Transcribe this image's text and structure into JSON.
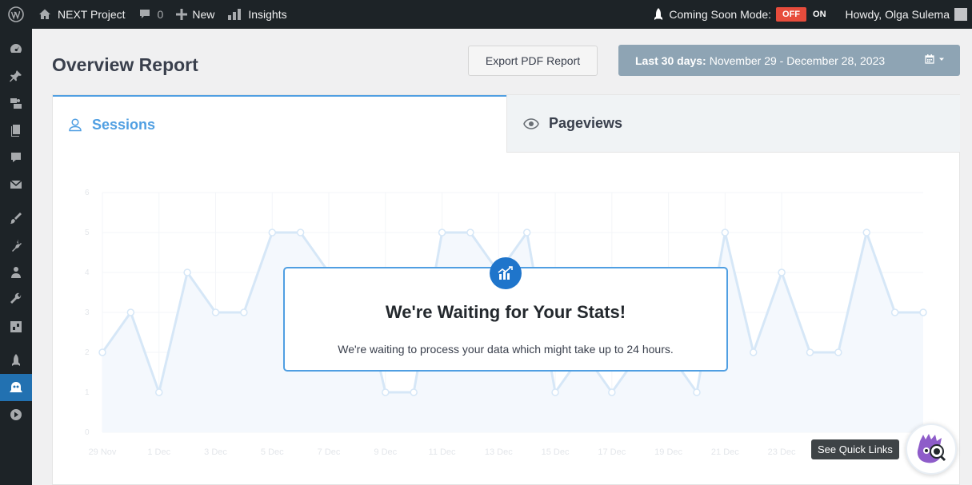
{
  "adminbar": {
    "site_name": "NEXT Project",
    "comments_count": "0",
    "new_label": "New",
    "insights_label": "Insights",
    "coming_soon_label": "Coming Soon Mode:",
    "off_label": "OFF",
    "on_label": "ON",
    "howdy": "Howdy, Olga Sulema"
  },
  "sidebar": {
    "items": [
      "dashboard-icon",
      "pin-icon",
      "media-icon",
      "pages-icon",
      "comments-icon",
      "mail-icon",
      "appearance-icon",
      "plugins-icon",
      "users-icon",
      "tools-icon",
      "settings-icon",
      "rocket-icon",
      "insights-icon",
      "play-icon"
    ]
  },
  "header": {
    "title": "Overview Report",
    "export_label": "Export PDF Report",
    "date_bold": "Last 30 days:",
    "date_range": "November 29 - December 28, 2023"
  },
  "tabs": [
    {
      "label": "Sessions"
    },
    {
      "label": "Pageviews"
    }
  ],
  "waiting": {
    "title": "We're Waiting for Your Stats!",
    "text": "We're waiting to process your data which might take up to 24 hours."
  },
  "quick_links": {
    "label": "See Quick Links"
  },
  "colors": {
    "accent": "#509fe2",
    "adminbar": "#1d2327",
    "off_badge": "#e74c3c",
    "date_range_bg": "#8ea4b4"
  },
  "chart_data": {
    "type": "line",
    "x": [
      "29 Nov",
      "30 Nov",
      "1 Dec",
      "2 Dec",
      "3 Dec",
      "4 Dec",
      "5 Dec",
      "6 Dec",
      "7 Dec",
      "8 Dec",
      "9 Dec",
      "10 Dec",
      "11 Dec",
      "12 Dec",
      "13 Dec",
      "14 Dec",
      "15 Dec",
      "16 Dec",
      "17 Dec",
      "18 Dec",
      "19 Dec",
      "20 Dec",
      "21 Dec",
      "22 Dec",
      "23 Dec",
      "24 Dec",
      "25 Dec",
      "26 Dec",
      "27 Dec",
      "28 Dec"
    ],
    "xticks": [
      "29 Nov",
      "1 Dec",
      "3 Dec",
      "5 Dec",
      "7 Dec",
      "9 Dec",
      "11 Dec",
      "13 Dec",
      "15 Dec",
      "17 Dec",
      "19 Dec",
      "21 Dec",
      "23 Dec"
    ],
    "yticks": [
      "0",
      "1",
      "2",
      "3",
      "4",
      "5",
      "6"
    ],
    "values": [
      2,
      3,
      1,
      4,
      3,
      3,
      5,
      5,
      4,
      4,
      1,
      1,
      5,
      5,
      4,
      5,
      1,
      2,
      1,
      2,
      2,
      1,
      5,
      2,
      4,
      2,
      2,
      5,
      3,
      3
    ],
    "ylim": [
      0,
      6
    ],
    "grid": true,
    "title": "",
    "xlabel": "",
    "ylabel": ""
  }
}
